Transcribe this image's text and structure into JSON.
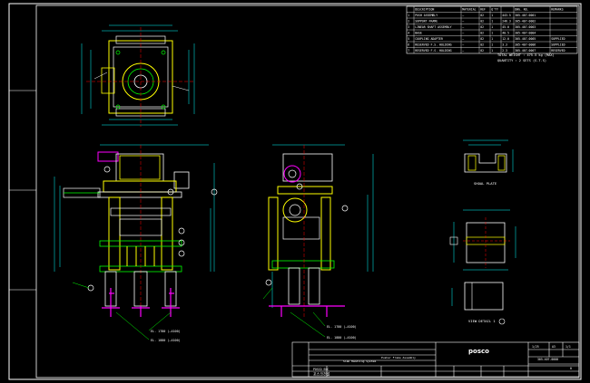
{
  "colors": {
    "background": "#000000",
    "outline": "#ffffff",
    "part": "#ffff00",
    "center": "#ff0000",
    "dimension": "#00ffff",
    "hatch": "#00ff00",
    "callout": "#ff00ff",
    "leader": "#00ff00"
  },
  "parts_table": {
    "headers": [
      "",
      "DESCRIPTION",
      "MATERIAL",
      "REF",
      "Q'TY",
      "",
      "DWG. NO.",
      "REMARKS"
    ],
    "rows": [
      [
        "1",
        "PUSH ASSEMBLY",
        "—",
        "02",
        "1",
        "443.5",
        "305-407-0001",
        ""
      ],
      [
        "2",
        "SUPPORT FRAME",
        "—",
        "02",
        "1",
        "246.3",
        "305-407-0002",
        ""
      ],
      [
        "3",
        "LINEAR SHAFT ASSEMBLY",
        "—",
        "02",
        "1",
        "45.0",
        "305-407-0003",
        ""
      ],
      [
        "4",
        "BASE",
        "—",
        "02",
        "1",
        "40.5",
        "305-407-0004",
        ""
      ],
      [
        "5",
        "COUPLING ADAPTER",
        "—",
        "02",
        "1",
        "12.0",
        "305-407-0005",
        "SUPPLIED"
      ],
      [
        "6",
        "RESERVED F.S. HOLDING",
        "—",
        "02",
        "1",
        "3.3",
        "305-407-0006",
        "SUPPLIED"
      ],
      [
        "7",
        "RESERVED F.S. HOLDING",
        "—",
        "02",
        "1",
        "2.3",
        "305-407-0007",
        "RESERVED"
      ]
    ]
  },
  "notes": {
    "line1": "TOTAL WEIGHT : 475.5 kg (MAX)",
    "line2": "QUANTITY : 2 SETS (S.T.S)"
  },
  "view_labels": {
    "detail_plate": "SHOAL PLATE",
    "detail_view": "VIEW  DETAIL  1",
    "elevation_note1": "EL. 1780 (—4100)",
    "elevation_note2": "EL. 1880 (—4100)",
    "elevation_note3": "EL. 1780 (—4100)",
    "elevation_note4": "EL. 1880 (—4100)"
  },
  "title_block": {
    "company": "posco",
    "company_korean": "포스코건설",
    "dept": "POSCO E&C",
    "project": "Slab Handling System",
    "title": "Pusher Frame Assembly",
    "dwg_no": "305-407-0000",
    "scale": "1/25",
    "size": "A3",
    "sheet": "1/1",
    "rev": "0"
  }
}
